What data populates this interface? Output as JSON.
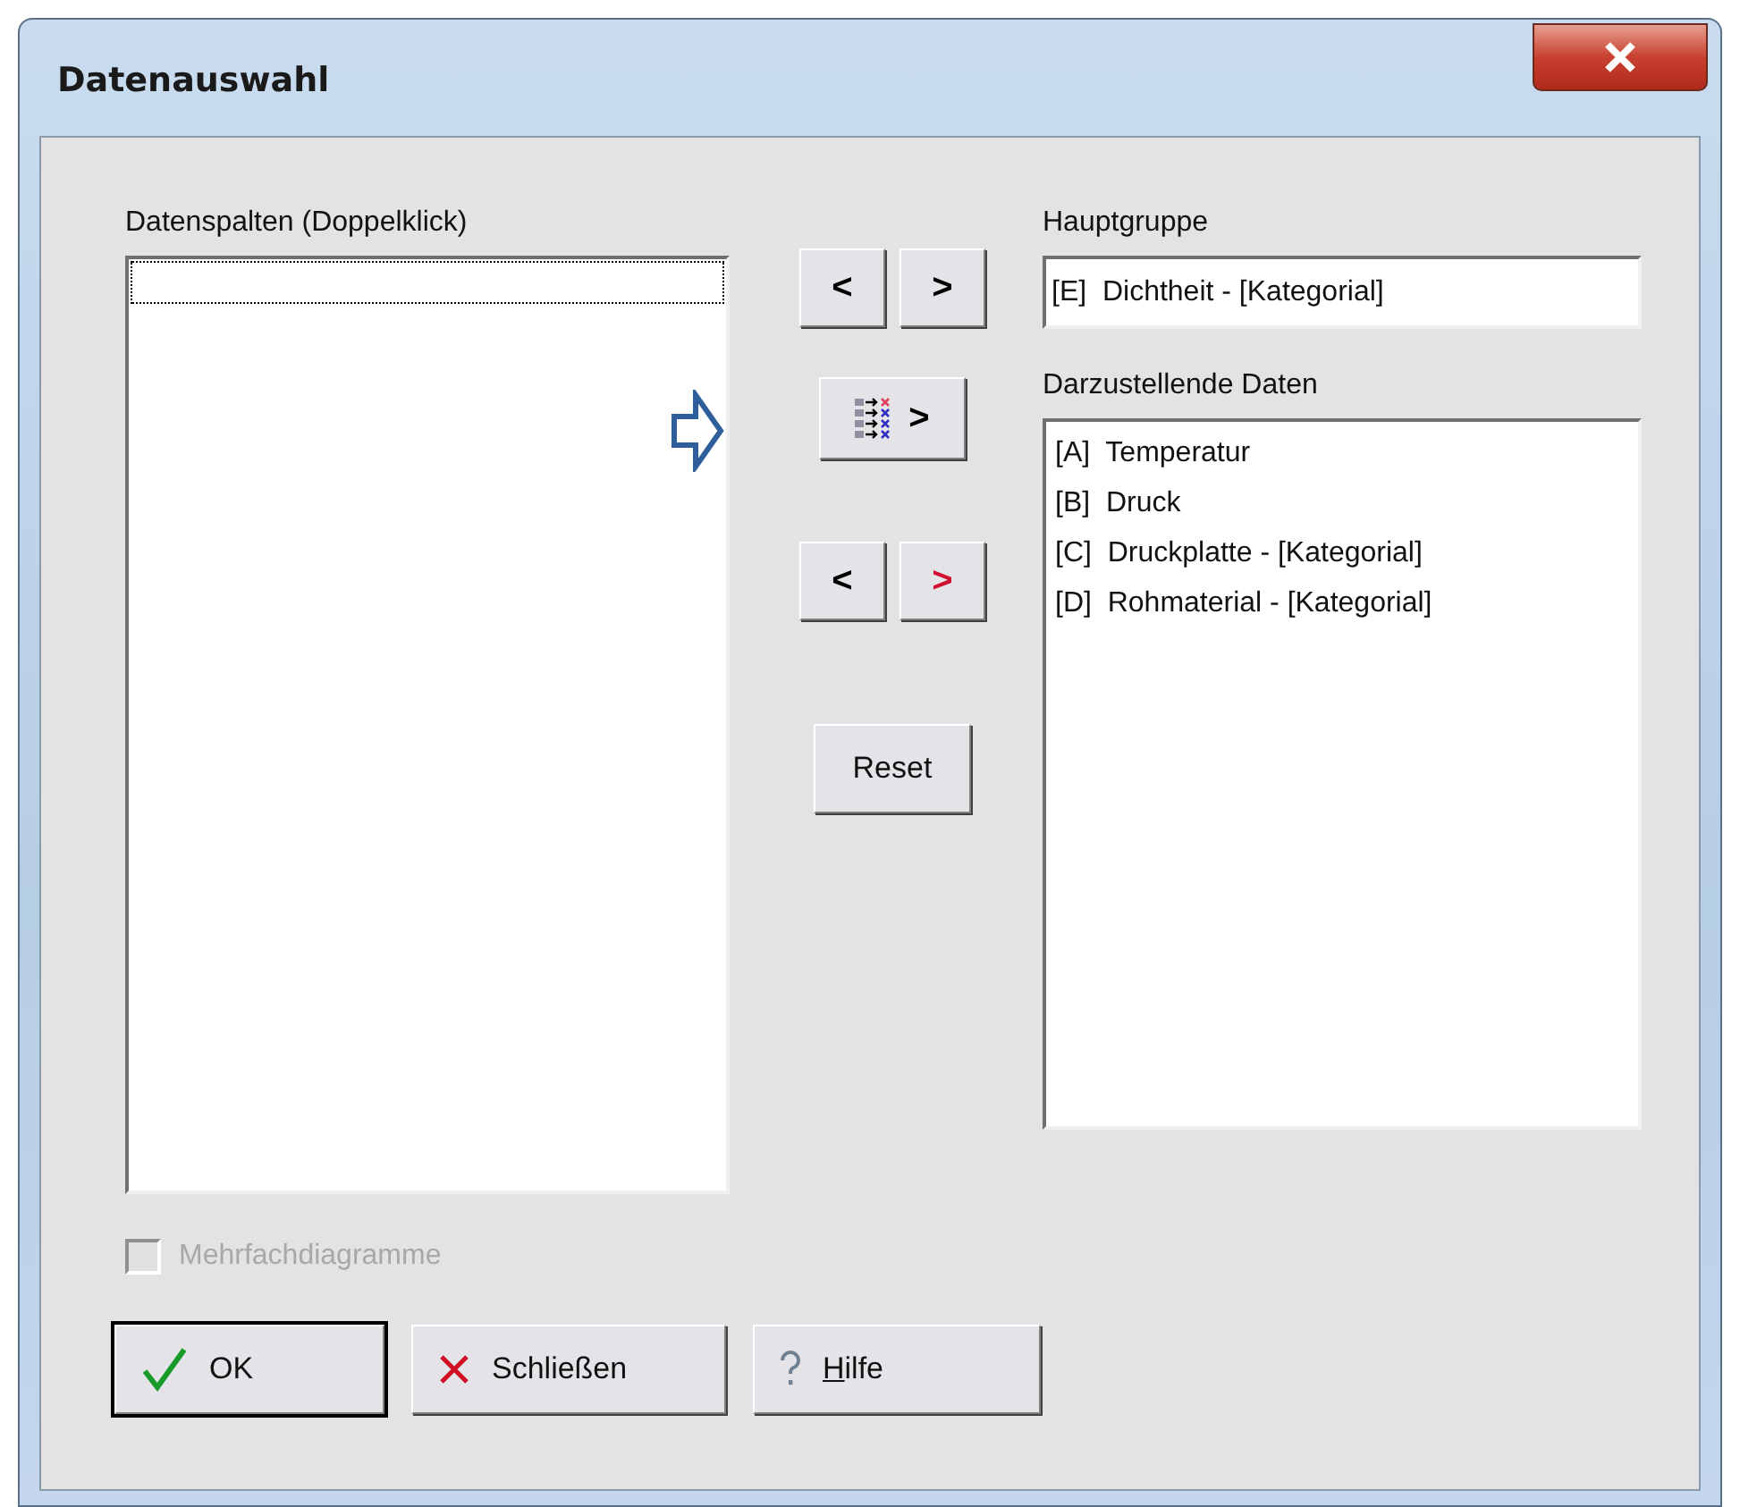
{
  "window": {
    "title": "Datenauswahl"
  },
  "source_list": {
    "label": "Datenspalten (Doppelklick)",
    "focused_row": true
  },
  "middle_buttons": [
    {
      "kind": "pair",
      "left": {
        "text": "<",
        "color": "#000000"
      },
      "right": {
        "text": ">",
        "color": "#000000"
      }
    },
    {
      "kind": "multi",
      "text": ">"
    },
    {
      "kind": "pair",
      "left": {
        "text": "<",
        "color": "#000000"
      },
      "right": {
        "text": ">",
        "color": "#d01030"
      }
    },
    {
      "kind": "reset",
      "text": "Reset"
    }
  ],
  "main_group": {
    "label": "Hauptgruppe",
    "value": "[E]  Dichtheit - [Kategorial]"
  },
  "display_data": {
    "label": "Darzustellende Daten",
    "items": [
      "[A]  Temperatur",
      "[B]  Druck",
      "[C]  Druckplatte - [Kategorial]",
      "[D]  Rohmaterial - [Kategorial]"
    ]
  },
  "multi_diagram": {
    "label": "Mehrfachdiagramme",
    "checked": false,
    "disabled": true
  },
  "buttons": [
    {
      "kind": "ok",
      "label": "OK",
      "default": true,
      "underline_first": false
    },
    {
      "kind": "close",
      "label": "Schließen",
      "default": false,
      "underline_first": false
    },
    {
      "kind": "help",
      "label": "Hilfe",
      "default": false,
      "underline_first": true
    }
  ]
}
